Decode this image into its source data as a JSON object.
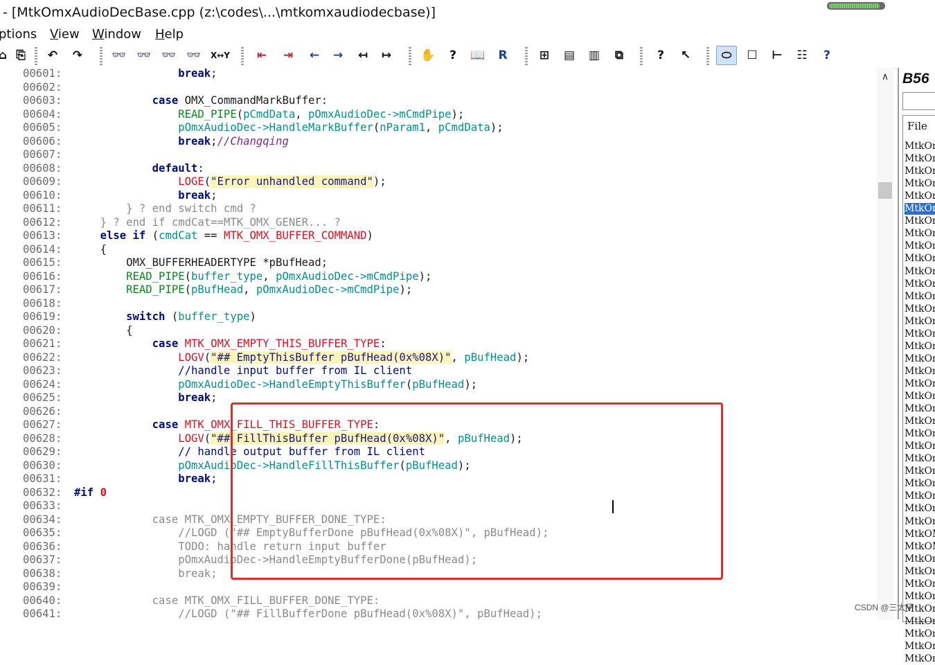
{
  "window": {
    "title": "- [MtkOmxAudioDecBase.cpp (z:\\codes\\...\\mtkomxaudiodecbase)]",
    "progress": 0.94
  },
  "menu": [
    {
      "label": "ptions",
      "accel": ""
    },
    {
      "label": "iew",
      "accel": "V"
    },
    {
      "label": "indow",
      "accel": "W"
    },
    {
      "label": "elp",
      "accel": "H"
    }
  ],
  "toolbar": {
    "icons": [
      "folder-icon",
      "paste-icon",
      "undo-icon",
      "redo-icon",
      "find-icon",
      "find-prev-icon",
      "find-next-icon",
      "find-files-icon",
      "replace-icon",
      "prev-bookmark-icon",
      "next-bookmark-icon",
      "back-arrow-icon",
      "forward-arrow-icon",
      "jump-left-icon",
      "jump-right-icon",
      "project-icon",
      "symbol-icon",
      "book-icon",
      "reference-icon",
      "layout-1-icon",
      "layout-2-icon",
      "layout-3-icon",
      "windows-icon",
      "context-help-icon",
      "whats-this-icon",
      "view-toggle-icon",
      "relation-icon",
      "tree-icon",
      "hierarchy-icon",
      "help-icon"
    ],
    "xy_label": "X↔Y"
  },
  "editor": {
    "lines": [
      {
        "num": "00601:",
        "indent": "                ",
        "tokens": [
          [
            "kw",
            "break"
          ],
          [
            "pun",
            ";"
          ]
        ]
      },
      {
        "num": "00602:",
        "indent": "",
        "tokens": []
      },
      {
        "num": "00603:",
        "indent": "            ",
        "tokens": [
          [
            "kw",
            "case "
          ],
          [
            "id",
            "OMX_CommandMarkBuffer"
          ],
          [
            "pun",
            ":"
          ]
        ]
      },
      {
        "num": "00604:",
        "indent": "                ",
        "tokens": [
          [
            "fn",
            "READ_PIPE"
          ],
          [
            "pun",
            "("
          ],
          [
            "mem",
            "pCmdData"
          ],
          [
            "pun",
            ", "
          ],
          [
            "mem",
            "pOmxAudioDec->mCmdPipe"
          ],
          [
            "pun",
            ");"
          ]
        ]
      },
      {
        "num": "00605:",
        "indent": "                ",
        "tokens": [
          [
            "mem",
            "pOmxAudioDec->HandleMarkBuffer"
          ],
          [
            "pun",
            "("
          ],
          [
            "mem",
            "nParam1"
          ],
          [
            "pun",
            ", "
          ],
          [
            "mem",
            "pCmdData"
          ],
          [
            "pun",
            ");"
          ]
        ]
      },
      {
        "num": "00606:",
        "indent": "                ",
        "tokens": [
          [
            "kw",
            "break"
          ],
          [
            "pun",
            ";"
          ],
          [
            "cmt",
            "//Changqing"
          ]
        ]
      },
      {
        "num": "00607:",
        "indent": "",
        "tokens": []
      },
      {
        "num": "00608:",
        "indent": "            ",
        "tokens": [
          [
            "kw",
            "default"
          ],
          [
            "pun",
            ":"
          ]
        ]
      },
      {
        "num": "00609:",
        "indent": "                ",
        "tokens": [
          [
            "mac",
            "LOGE"
          ],
          [
            "pun",
            "("
          ],
          [
            "str",
            "\"Error unhandled command\""
          ],
          [
            "pun",
            ");"
          ]
        ]
      },
      {
        "num": "00610:",
        "indent": "                ",
        "tokens": [
          [
            "kw",
            "break"
          ],
          [
            "pun",
            ";"
          ]
        ]
      },
      {
        "num": "00611:",
        "indent": "        ",
        "tokens": [
          [
            "dis",
            "} ? end switch cmd ?"
          ]
        ]
      },
      {
        "num": "00612:",
        "indent": "    ",
        "tokens": [
          [
            "dis",
            "} ? end if cmdCat==MTK_OMX_GENER... ?"
          ]
        ]
      },
      {
        "num": "00613:",
        "indent": "    ",
        "tokens": [
          [
            "kw",
            "else if "
          ],
          [
            "pun",
            "("
          ],
          [
            "mem",
            "cmdCat"
          ],
          [
            "pun",
            " == "
          ],
          [
            "mac",
            "MTK_OMX_BUFFER_COMMAND"
          ],
          [
            "pun",
            ")"
          ]
        ]
      },
      {
        "num": "00614:",
        "indent": "    ",
        "tokens": [
          [
            "pun",
            "{"
          ]
        ]
      },
      {
        "num": "00615:",
        "indent": "        ",
        "tokens": [
          [
            "id",
            "OMX_BUFFERHEADERTYPE "
          ],
          [
            "pun",
            "*"
          ],
          [
            "id",
            "pBufHead"
          ],
          [
            "pun",
            ";"
          ]
        ]
      },
      {
        "num": "00616:",
        "indent": "        ",
        "tokens": [
          [
            "fn",
            "READ_PIPE"
          ],
          [
            "pun",
            "("
          ],
          [
            "mem",
            "buffer_type"
          ],
          [
            "pun",
            ", "
          ],
          [
            "mem",
            "pOmxAudioDec->mCmdPipe"
          ],
          [
            "pun",
            ");"
          ]
        ]
      },
      {
        "num": "00617:",
        "indent": "        ",
        "tokens": [
          [
            "fn",
            "READ_PIPE"
          ],
          [
            "pun",
            "("
          ],
          [
            "mem",
            "pBufHead"
          ],
          [
            "pun",
            ", "
          ],
          [
            "mem",
            "pOmxAudioDec->mCmdPipe"
          ],
          [
            "pun",
            ");"
          ]
        ]
      },
      {
        "num": "00618:",
        "indent": "",
        "tokens": []
      },
      {
        "num": "00619:",
        "indent": "        ",
        "tokens": [
          [
            "kw",
            "switch "
          ],
          [
            "pun",
            "("
          ],
          [
            "mem",
            "buffer_type"
          ],
          [
            "pun",
            ")"
          ]
        ]
      },
      {
        "num": "00620:",
        "indent": "        ",
        "tokens": [
          [
            "pun",
            "{"
          ]
        ]
      },
      {
        "num": "00621:",
        "indent": "            ",
        "tokens": [
          [
            "kw",
            "case "
          ],
          [
            "mac",
            "MTK_OMX_EMPTY_THIS_BUFFER_TYPE"
          ],
          [
            "pun",
            ":"
          ]
        ]
      },
      {
        "num": "00622:",
        "indent": "                ",
        "tokens": [
          [
            "mac",
            "LOGV"
          ],
          [
            "pun",
            "("
          ],
          [
            "str",
            "\"## EmptyThisBuffer pBufHead(0x%08X)\""
          ],
          [
            "pun",
            ", "
          ],
          [
            "mem",
            "pBufHead"
          ],
          [
            "pun",
            ");"
          ]
        ]
      },
      {
        "num": "00623:",
        "indent": "                ",
        "tokens": [
          [
            "kwc",
            "//handle input buffer from IL client"
          ]
        ]
      },
      {
        "num": "00624:",
        "indent": "                ",
        "tokens": [
          [
            "mem",
            "pOmxAudioDec->HandleEmptyThisBuffer"
          ],
          [
            "pun",
            "("
          ],
          [
            "mem",
            "pBufHead"
          ],
          [
            "pun",
            ");"
          ]
        ]
      },
      {
        "num": "00625:",
        "indent": "                ",
        "tokens": [
          [
            "kw",
            "break"
          ],
          [
            "pun",
            ";"
          ]
        ]
      },
      {
        "num": "00626:",
        "indent": "",
        "tokens": []
      },
      {
        "num": "00627:",
        "indent": "            ",
        "tokens": [
          [
            "kw",
            "case "
          ],
          [
            "mac",
            "MTK_OMX_FILL_THIS_BUFFER_TYPE"
          ],
          [
            "pun",
            ":"
          ]
        ]
      },
      {
        "num": "00628:",
        "indent": "                ",
        "tokens": [
          [
            "mac",
            "LOGV"
          ],
          [
            "pun",
            "("
          ],
          [
            "str",
            "\"## FillThisBuffer pBufHead(0x%08X)\""
          ],
          [
            "pun",
            ", "
          ],
          [
            "mem",
            "pBufHead"
          ],
          [
            "pun",
            ");"
          ]
        ]
      },
      {
        "num": "00629:",
        "indent": "                ",
        "tokens": [
          [
            "kwc",
            "// handle output buffer from IL client"
          ]
        ]
      },
      {
        "num": "00630:",
        "indent": "                ",
        "tokens": [
          [
            "mem",
            "pOmxAudioDec->HandleFillThisBuffer"
          ],
          [
            "pun",
            "("
          ],
          [
            "mem",
            "pBufHead"
          ],
          [
            "pun",
            ");"
          ]
        ]
      },
      {
        "num": "00631:",
        "indent": "                ",
        "tokens": [
          [
            "kw",
            "break"
          ],
          [
            "pun",
            ";"
          ]
        ]
      },
      {
        "num": "00632:",
        "indent": "",
        "tokens": [
          [
            "kw",
            "#if "
          ],
          [
            "num",
            "0"
          ]
        ]
      },
      {
        "num": "00633:",
        "indent": "",
        "tokens": []
      },
      {
        "num": "00634:",
        "indent": "            ",
        "tokens": [
          [
            "dis",
            "case MTK_OMX_EMPTY_BUFFER_DONE_TYPE:"
          ]
        ]
      },
      {
        "num": "00635:",
        "indent": "                ",
        "tokens": [
          [
            "dis",
            "//LOGD (\"## EmptyBufferDone pBufHead(0x%08X)\", pBufHead);"
          ]
        ]
      },
      {
        "num": "00636:",
        "indent": "                ",
        "tokens": [
          [
            "dis",
            "TODO: handle return input buffer"
          ]
        ]
      },
      {
        "num": "00637:",
        "indent": "                ",
        "tokens": [
          [
            "dis",
            "pOmxAudioDec->HandleEmptyBufferDone(pBufHead);"
          ]
        ]
      },
      {
        "num": "00638:",
        "indent": "                ",
        "tokens": [
          [
            "dis",
            "break;"
          ]
        ]
      },
      {
        "num": "00639:",
        "indent": "",
        "tokens": []
      },
      {
        "num": "00640:",
        "indent": "            ",
        "tokens": [
          [
            "dis",
            "case MTK_OMX_FILL_BUFFER_DONE_TYPE:"
          ]
        ]
      },
      {
        "num": "00641:",
        "indent": "                ",
        "tokens": [
          [
            "dis",
            "//LOGD (\"## FillBufferDone pBufHead(0x%08X)\", pBufHead);"
          ]
        ]
      }
    ]
  },
  "side_panel": {
    "title": "B56",
    "list_header": "File",
    "files": [
      "MtkOm",
      "MtkOm",
      "MtkOm",
      "MtkOm",
      "MtkOm",
      "MtkOm",
      "MtkOm",
      "MtkOm",
      "MtkOm",
      "MtkOm",
      "MtkOm",
      "MtkOm",
      "MtkOm",
      "MtkOm",
      "MtkOm",
      "MtkOm",
      "MtkOm",
      "MtkOm",
      "MtkOm",
      "MtkOm",
      "MtkOm",
      "MtkOm",
      "MtkOm",
      "MtkOm",
      "MtkOm",
      "MtkOm",
      "MtkOm",
      "MtkOm",
      "MtkOm",
      "MtkOm",
      "MtkOm",
      "MtkOM",
      "MtkOM",
      "MtkOm",
      "MtkOm",
      "MtkOm",
      "MtkOm",
      "MtkOm",
      "MtkOm",
      "MtkOm",
      "MtkOm",
      "MtkOm"
    ],
    "selected_index": 5
  },
  "watermark": "CSDN @三太子",
  "colors": {
    "highlight_box": "#e32b2b",
    "selection": "#2a6fd6"
  }
}
